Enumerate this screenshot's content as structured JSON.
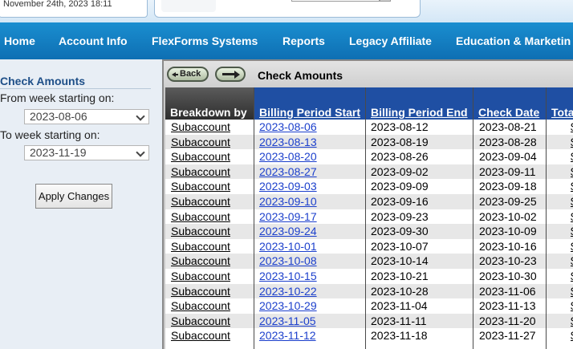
{
  "header": {
    "date": "November 24th, 2023 18:11"
  },
  "nav": [
    {
      "label": "Home"
    },
    {
      "label": "Account Info"
    },
    {
      "label": "FlexForms Systems"
    },
    {
      "label": "Reports"
    },
    {
      "label": "Legacy Affiliate"
    },
    {
      "label": "Education & Marketin"
    }
  ],
  "sidebar": {
    "title": "Check Amounts",
    "from_label": "From week starting on:",
    "from_value": "2023-08-06",
    "to_label": "To week starting on:",
    "to_value": "2023-11-19",
    "apply_label": "Apply Changes"
  },
  "toolbar": {
    "back_label": "Back",
    "title": "Check Amounts"
  },
  "table": {
    "columns": [
      "Breakdown by",
      "Billing Period Start",
      "Billing Period End",
      "Check Date",
      "Tota"
    ],
    "rows": [
      {
        "breakdown": "Subaccount",
        "start": "2023-08-06",
        "end": "2023-08-12",
        "check": "2023-08-21",
        "total": "$"
      },
      {
        "breakdown": "Subaccount",
        "start": "2023-08-13",
        "end": "2023-08-19",
        "check": "2023-08-28",
        "total": "$"
      },
      {
        "breakdown": "Subaccount",
        "start": "2023-08-20",
        "end": "2023-08-26",
        "check": "2023-09-04",
        "total": "$"
      },
      {
        "breakdown": "Subaccount",
        "start": "2023-08-27",
        "end": "2023-09-02",
        "check": "2023-09-11",
        "total": "$"
      },
      {
        "breakdown": "Subaccount",
        "start": "2023-09-03",
        "end": "2023-09-09",
        "check": "2023-09-18",
        "total": "$"
      },
      {
        "breakdown": "Subaccount",
        "start": "2023-09-10",
        "end": "2023-09-16",
        "check": "2023-09-25",
        "total": "$"
      },
      {
        "breakdown": "Subaccount",
        "start": "2023-09-17",
        "end": "2023-09-23",
        "check": "2023-10-02",
        "total": "$"
      },
      {
        "breakdown": "Subaccount",
        "start": "2023-09-24",
        "end": "2023-09-30",
        "check": "2023-10-09",
        "total": "$"
      },
      {
        "breakdown": "Subaccount",
        "start": "2023-10-01",
        "end": "2023-10-07",
        "check": "2023-10-16",
        "total": "$"
      },
      {
        "breakdown": "Subaccount",
        "start": "2023-10-08",
        "end": "2023-10-14",
        "check": "2023-10-23",
        "total": "$"
      },
      {
        "breakdown": "Subaccount",
        "start": "2023-10-15",
        "end": "2023-10-21",
        "check": "2023-10-30",
        "total": "$"
      },
      {
        "breakdown": "Subaccount",
        "start": "2023-10-22",
        "end": "2023-10-28",
        "check": "2023-11-06",
        "total": "$"
      },
      {
        "breakdown": "Subaccount",
        "start": "2023-10-29",
        "end": "2023-11-04",
        "check": "2023-11-13",
        "total": "$"
      },
      {
        "breakdown": "Subaccount",
        "start": "2023-11-05",
        "end": "2023-11-11",
        "check": "2023-11-20",
        "total": "$"
      },
      {
        "breakdown": "Subaccount",
        "start": "2023-11-12",
        "end": "2023-11-18",
        "check": "2023-11-27",
        "total": "$"
      }
    ]
  }
}
